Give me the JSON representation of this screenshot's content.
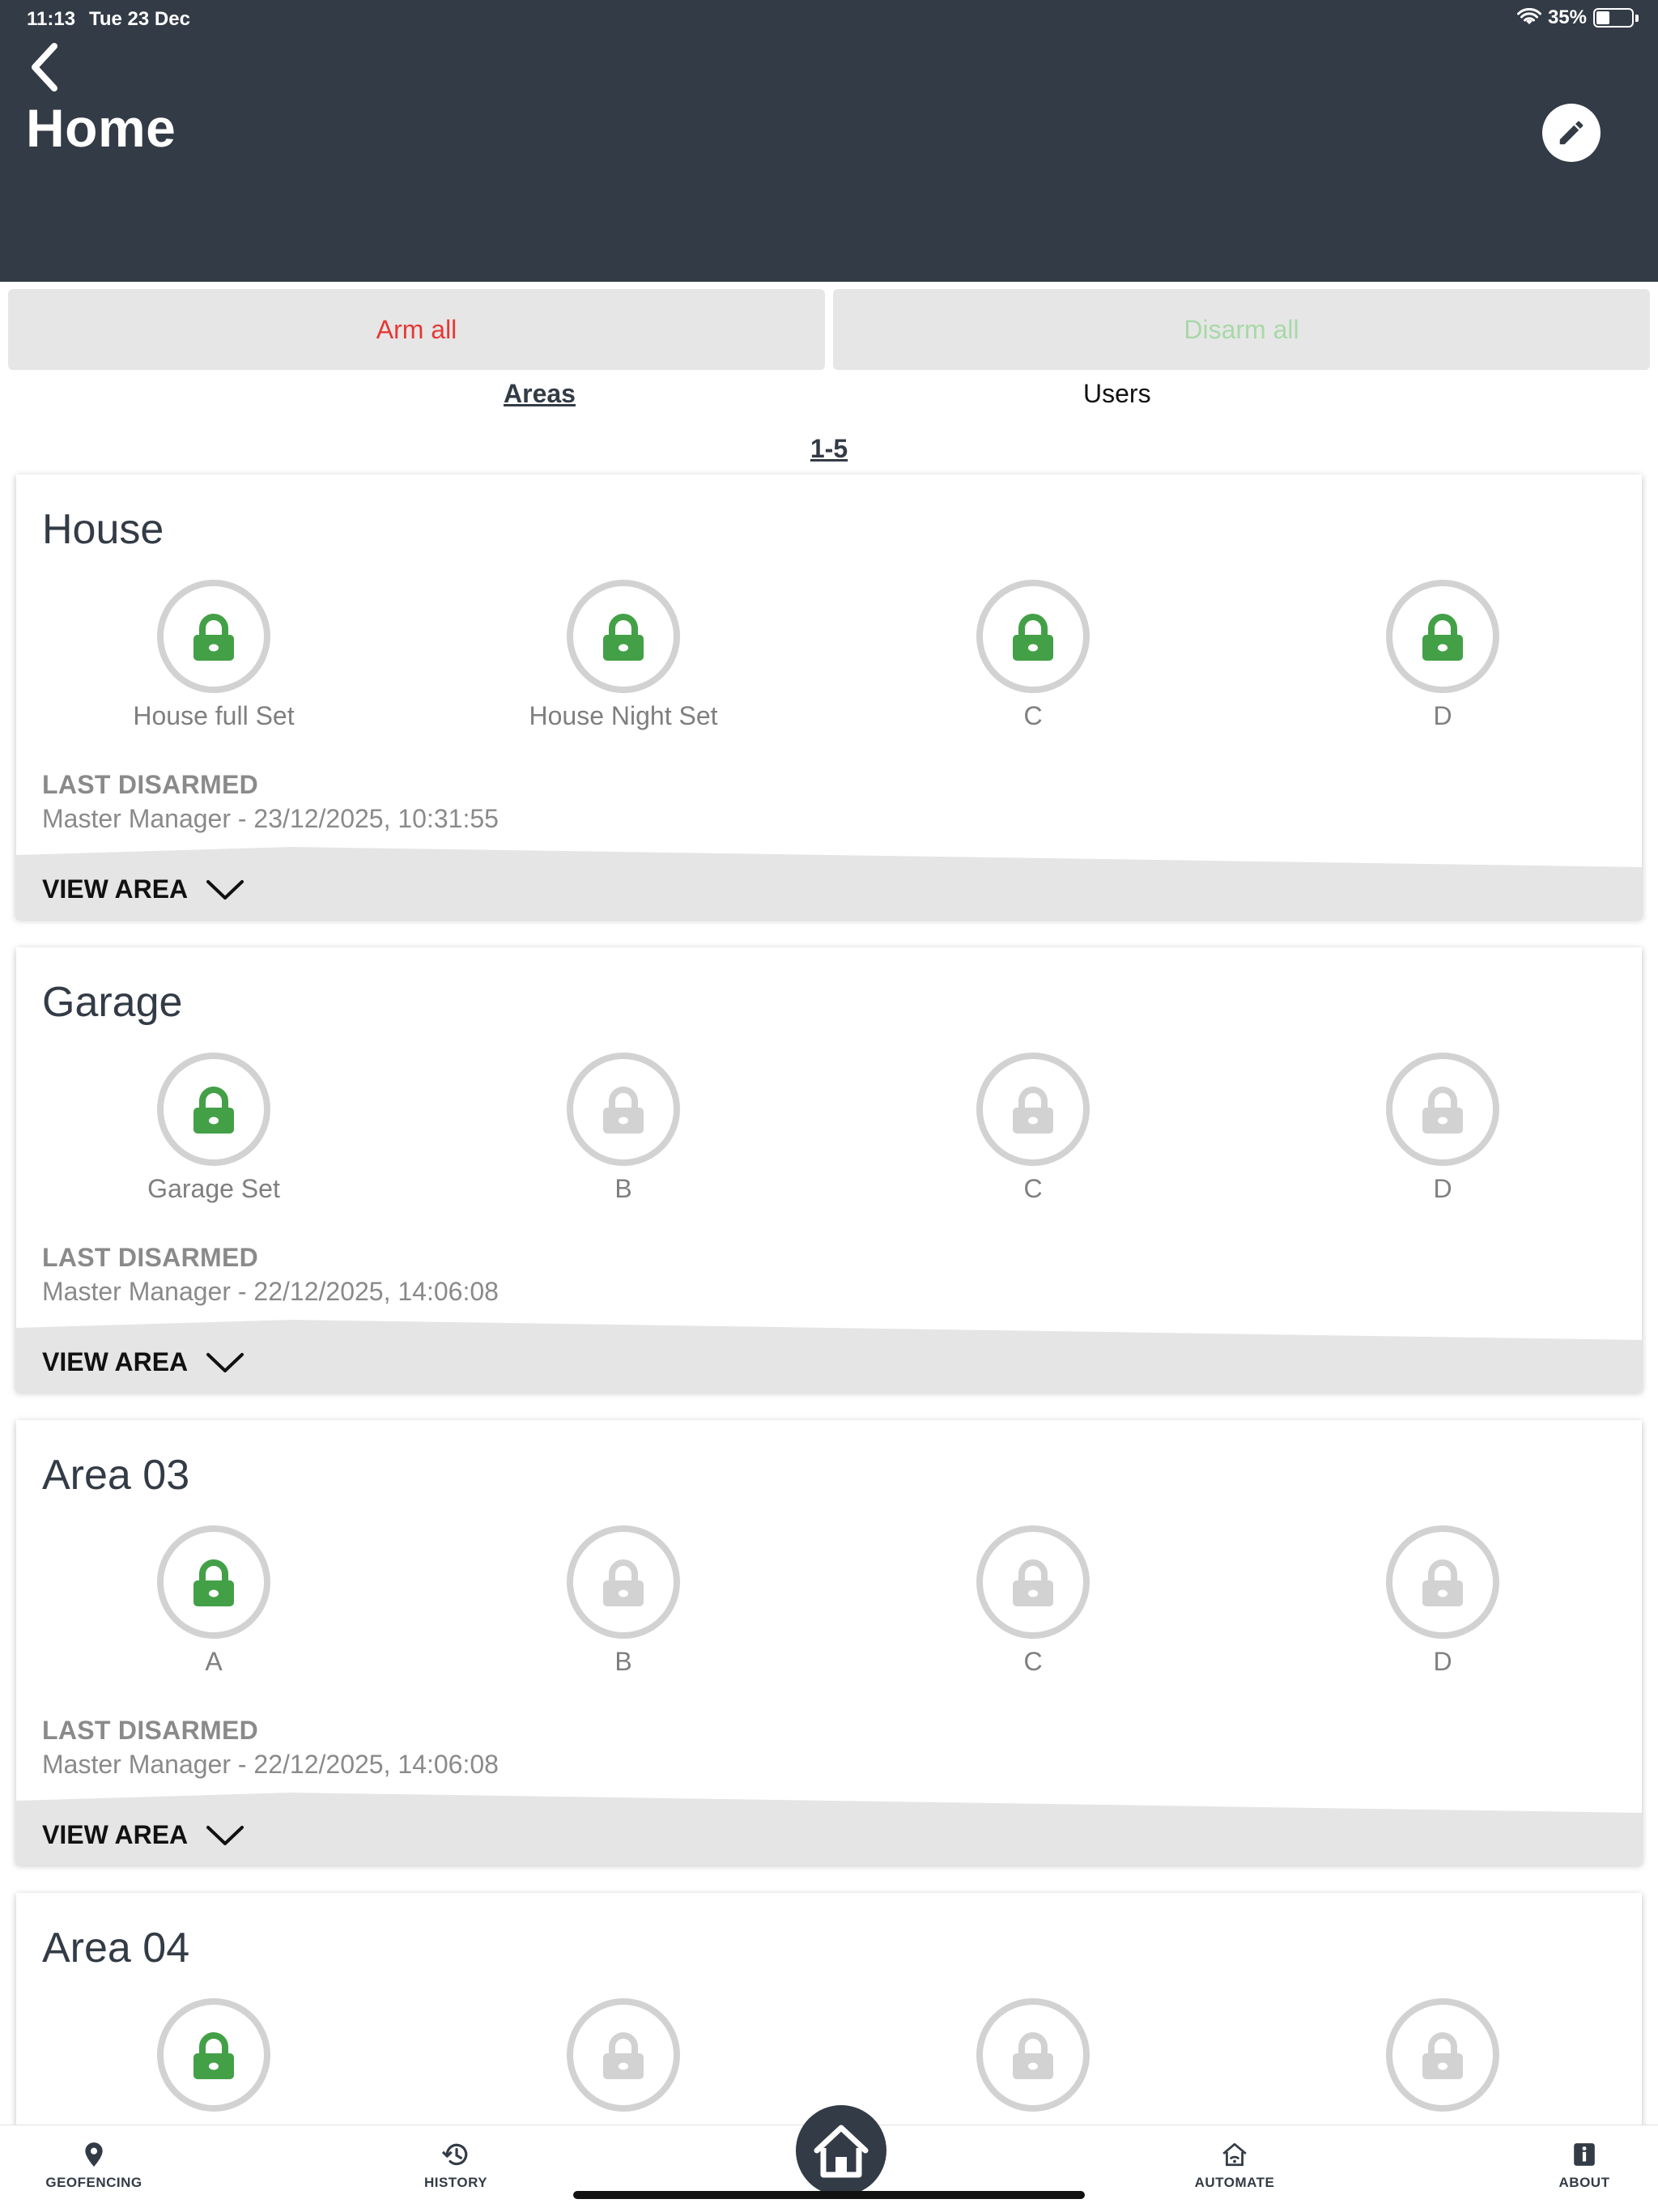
{
  "status_bar": {
    "time": "11:13",
    "date": "Tue 23 Dec",
    "battery": "35%",
    "battery_level": 0.35
  },
  "header": {
    "title": "Home"
  },
  "actions": {
    "arm_all": "Arm all",
    "disarm_all": "Disarm all"
  },
  "tabs": {
    "areas": "Areas",
    "users": "Users"
  },
  "pager": "1-5",
  "colors": {
    "header_bg": "#333b46",
    "armed_green": "#43a047",
    "disarmed_grey": "#d2d2d2",
    "arm_red": "#e53935",
    "disarm_green_faded": "#a8d8a9"
  },
  "areas": [
    {
      "name": "House",
      "partitions": [
        {
          "label": "House full Set",
          "state": "green"
        },
        {
          "label": "House Night Set",
          "state": "green"
        },
        {
          "label": "C",
          "state": "green"
        },
        {
          "label": "D",
          "state": "green"
        }
      ],
      "last_label": "LAST DISARMED",
      "last_value": "Master Manager - 23/12/2025, 10:31:55",
      "view_area": "VIEW AREA"
    },
    {
      "name": "Garage",
      "partitions": [
        {
          "label": "Garage Set",
          "state": "green"
        },
        {
          "label": "B",
          "state": "grey"
        },
        {
          "label": "C",
          "state": "grey"
        },
        {
          "label": "D",
          "state": "grey"
        }
      ],
      "last_label": "LAST DISARMED",
      "last_value": "Master Manager - 22/12/2025, 14:06:08",
      "view_area": "VIEW AREA"
    },
    {
      "name": "Area 03",
      "partitions": [
        {
          "label": "A",
          "state": "green"
        },
        {
          "label": "B",
          "state": "grey"
        },
        {
          "label": "C",
          "state": "grey"
        },
        {
          "label": "D",
          "state": "grey"
        }
      ],
      "last_label": "LAST DISARMED",
      "last_value": "Master Manager - 22/12/2025, 14:06:08",
      "view_area": "VIEW AREA"
    },
    {
      "name": "Area 04",
      "partitions": [
        {
          "state": "green"
        },
        {
          "state": "grey"
        },
        {
          "state": "grey"
        },
        {
          "state": "grey"
        }
      ]
    }
  ],
  "bottom_nav": {
    "geofencing": "GEOFENCING",
    "history": "HISTORY",
    "automate": "AUTOMATE",
    "about": "ABOUT"
  }
}
